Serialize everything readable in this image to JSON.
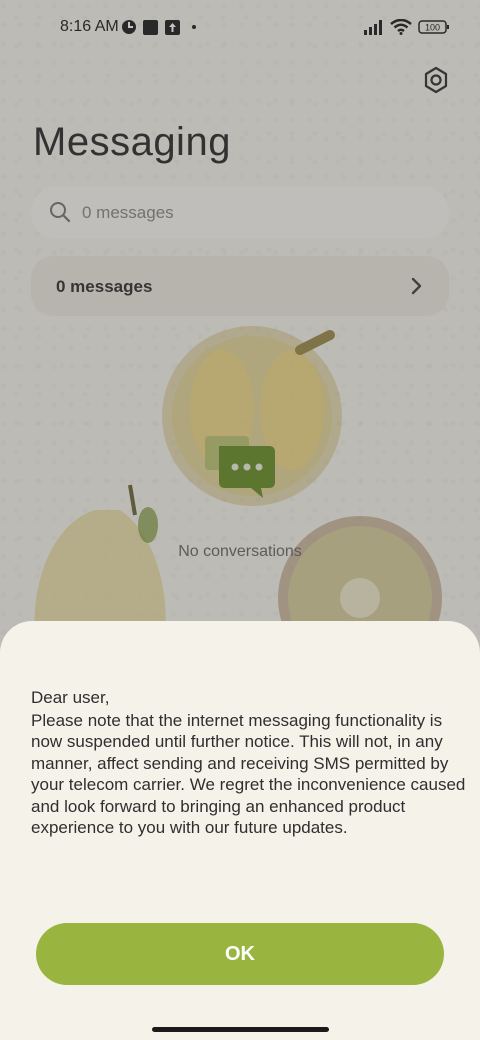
{
  "status_bar": {
    "time": "8:16 AM",
    "battery": "100",
    "icons": [
      "vpn-icon",
      "square-icon",
      "upload-icon",
      "dot-icon",
      "signal-icon",
      "wifi-icon",
      "battery-icon"
    ]
  },
  "header": {
    "title": "Messaging",
    "settings_icon": "settings-icon"
  },
  "search": {
    "placeholder": "0 messages"
  },
  "messages_row": {
    "label": "0 messages"
  },
  "empty_state": {
    "text": "No conversations"
  },
  "dialog": {
    "greeting": "Dear user,",
    "body": "Please note that the internet messaging functionality is now suspended until further notice. This will not, in any manner, affect sending and receiving SMS permitted by your telecom carrier. We regret the inconvenience caused and look forward to bringing an enhanced product experience to you with our future updates.",
    "ok_label": "OK"
  },
  "colors": {
    "accent": "#99b43f",
    "icon_green": "#6b8f2a"
  }
}
